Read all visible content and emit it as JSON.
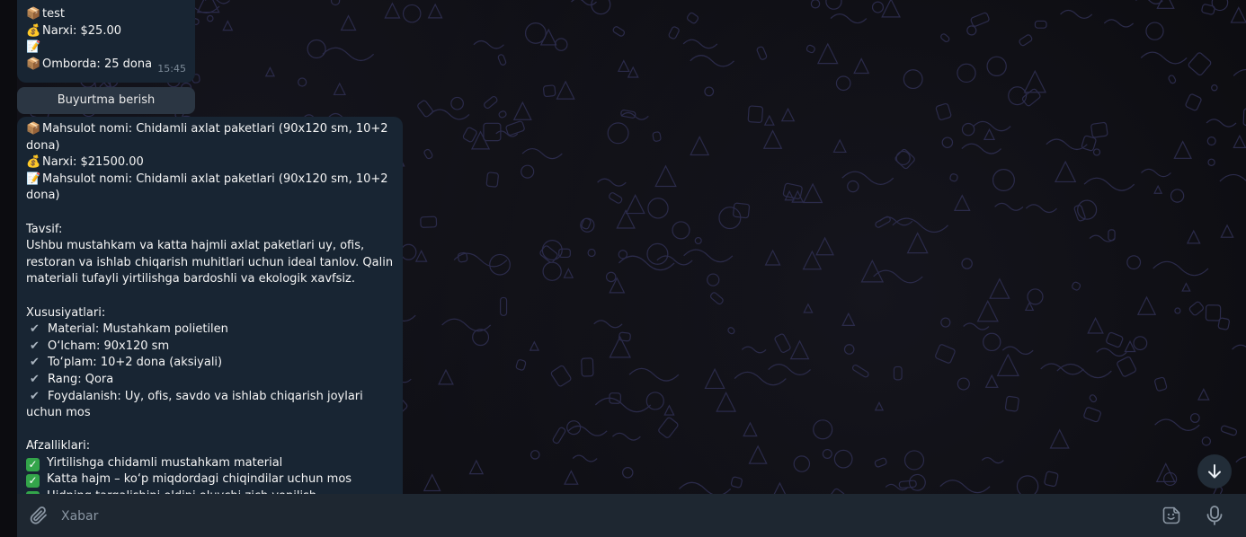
{
  "chat": {
    "wallpaper_color": "#0c0c10",
    "bubble_color": "#182533",
    "doodle_color": "#2b2b4a"
  },
  "top_message": {
    "lines": [
      {
        "emoji": "📦",
        "text": "test"
      },
      {
        "emoji": "💰",
        "text": "Narxi: $25.00"
      },
      {
        "emoji": "📝",
        "text": ""
      },
      {
        "emoji": "📦",
        "text": "Omborda: 25 dona"
      }
    ],
    "time": "15:45"
  },
  "order_button": {
    "label": "Buyurtma berish"
  },
  "main_message": {
    "name_line": {
      "emoji": "📦",
      "text": "Mahsulot nomi: Chidamli axlat paketlari (90x120 sm, 10+2 dona)"
    },
    "price_line": {
      "emoji": "💰",
      "text": "Narxi: $21500.00"
    },
    "desc_line": {
      "emoji": "📝",
      "text": "Mahsulot nomi: Chidamli axlat paketlari (90x120 sm, 10+2 dona)"
    },
    "tavsif_heading": "Tavsif:",
    "tavsif_text": "Ushbu mustahkam va katta hajmli axlat paketlari uy, ofis, restoran va ishlab chiqarish muhitlari uchun ideal tanlov. Qalin materiali tufayli yirtilishga bardoshli va ekologik xavfsiz.",
    "features_heading": "Xususiyatlari:",
    "features": [
      "Material: Mustahkam polietilen",
      "O‘lcham: 90x120 sm",
      "To‘plam: 10+2 dona (aksiyali)",
      "Rang: Qora",
      "Foydalanish: Uy, ofis, savdo va ishlab chiqarish joylari uchun mos"
    ],
    "advantages_heading": "Afzalliklari:",
    "advantages": [
      "Yirtilishga chidamli mustahkam material",
      "Katta hajm – ko‘p miqdordagi chiqindilar uchun mos",
      "Hidning tarqalishini oldini oluvchi zich yopilish"
    ]
  },
  "composer": {
    "placeholder": "Xabar",
    "attach_icon": "paperclip-icon",
    "sticker_icon": "sticker-icon",
    "mic_icon": "microphone-icon"
  },
  "scroll_button": {
    "icon": "arrow-down-icon"
  }
}
